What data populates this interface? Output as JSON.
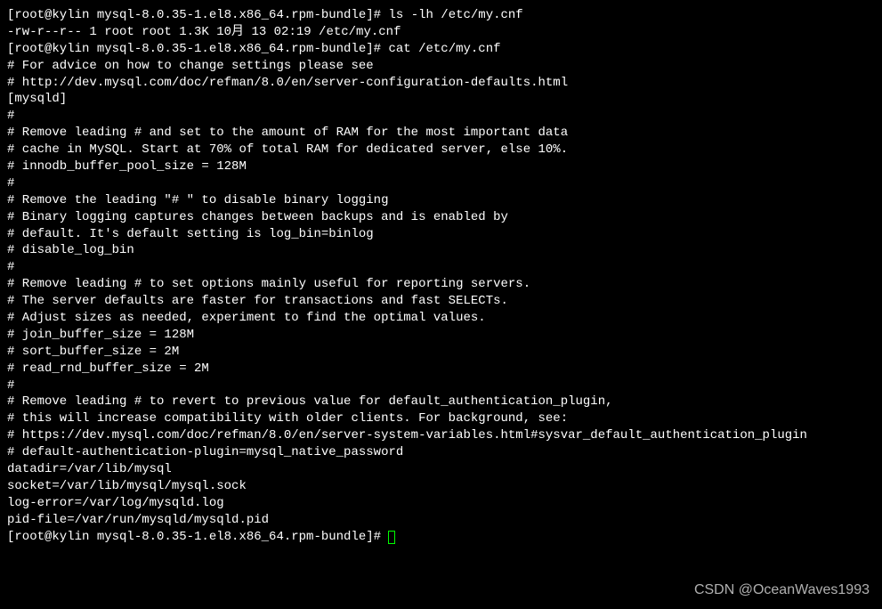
{
  "prompt1": "[root@kylin mysql-8.0.35-1.el8.x86_64.rpm-bundle]# ",
  "cmd1": "ls -lh /etc/my.cnf",
  "ls_output": "-rw-r--r-- 1 root root 1.3K 10月 13 02:19 /etc/my.cnf",
  "prompt2": "[root@kylin mysql-8.0.35-1.el8.x86_64.rpm-bundle]# ",
  "cmd2": "cat /etc/my.cnf",
  "file": {
    "l1": "# For advice on how to change settings please see",
    "l2": "# http://dev.mysql.com/doc/refman/8.0/en/server-configuration-defaults.html",
    "l3": "",
    "l4": "[mysqld]",
    "l5": "#",
    "l6": "# Remove leading # and set to the amount of RAM for the most important data",
    "l7": "# cache in MySQL. Start at 70% of total RAM for dedicated server, else 10%.",
    "l8": "# innodb_buffer_pool_size = 128M",
    "l9": "#",
    "l10": "# Remove the leading \"# \" to disable binary logging",
    "l11": "# Binary logging captures changes between backups and is enabled by",
    "l12": "# default. It's default setting is log_bin=binlog",
    "l13": "# disable_log_bin",
    "l14": "#",
    "l15": "# Remove leading # to set options mainly useful for reporting servers.",
    "l16": "# The server defaults are faster for transactions and fast SELECTs.",
    "l17": "# Adjust sizes as needed, experiment to find the optimal values.",
    "l18": "# join_buffer_size = 128M",
    "l19": "# sort_buffer_size = 2M",
    "l20": "# read_rnd_buffer_size = 2M",
    "l21": "#",
    "l22": "# Remove leading # to revert to previous value for default_authentication_plugin,",
    "l23": "# this will increase compatibility with older clients. For background, see:",
    "l24": "# https://dev.mysql.com/doc/refman/8.0/en/server-system-variables.html#sysvar_default_authentication_plugin",
    "l25": "# default-authentication-plugin=mysql_native_password",
    "l26": "",
    "l27": "datadir=/var/lib/mysql",
    "l28": "socket=/var/lib/mysql/mysql.sock",
    "l29": "",
    "l30": "log-error=/var/log/mysqld.log",
    "l31": "pid-file=/var/run/mysqld/mysqld.pid"
  },
  "prompt3": "[root@kylin mysql-8.0.35-1.el8.x86_64.rpm-bundle]# ",
  "watermark": "CSDN @OceanWaves1993"
}
